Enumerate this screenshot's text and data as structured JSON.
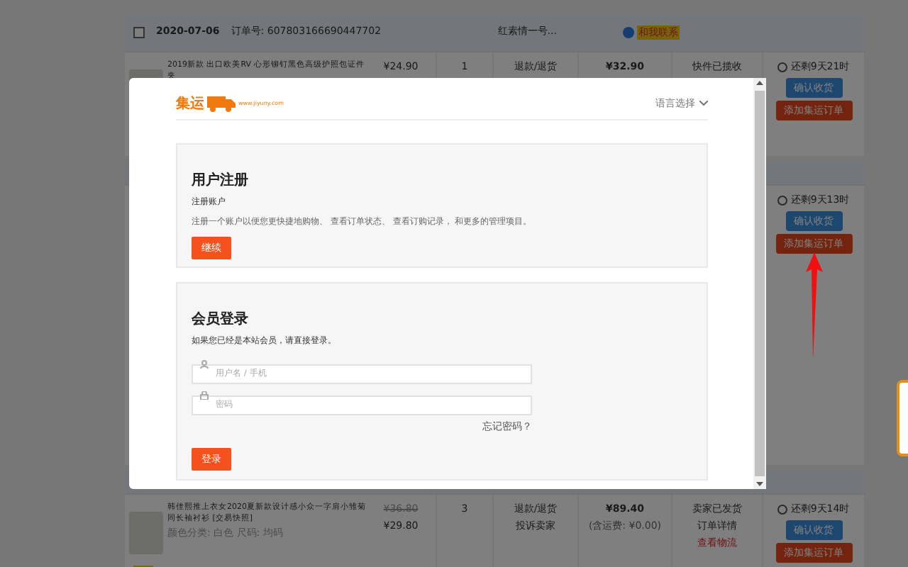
{
  "orders": [
    {
      "header": {
        "checked": false,
        "date": "2020-07-06",
        "order_no": "订单号: 607803166690447702",
        "shop": "红素情一号...",
        "contact": "和我联系"
      },
      "item": {
        "title": "2019新款 出口欧美RV 心形铆钉黑色高级护照包证件夹",
        "price": "¥24.90",
        "quantity": "1",
        "service": [
          "退款/退货"
        ],
        "total": "¥32.90",
        "shipping_status": [
          "快件已揽收"
        ],
        "countdown": "还剩9天21时",
        "buttons": [
          "确认收货",
          "添加集运订单"
        ]
      }
    },
    {
      "item": {
        "countdown": "还剩9天13时",
        "buttons": [
          "确认收货",
          "添加集运订单"
        ]
      }
    },
    {
      "item": {
        "title": "韩佳熙推上衣女2020夏新款设计感小众一字肩小雏菊同长袖衬衫 [交易快照]",
        "variant": "颜色分类: 白色  尺码: 均码",
        "old_price": "¥36.80",
        "price": "¥29.80",
        "quantity": "3",
        "service": [
          "退款/退货",
          "投诉卖家"
        ],
        "total": "¥89.40",
        "shipping_fee": "(含运费: ¥0.00)",
        "shipping_status": [
          "卖家已发货",
          "订单详情",
          "查看物流"
        ],
        "countdown": "还剩9天14时",
        "buttons": [
          "确认收货",
          "添加集运订单"
        ]
      }
    }
  ],
  "dialog": {
    "logo": {
      "text": "集运",
      "url": "www.jiyuny.com"
    },
    "language": "语言选择",
    "register": {
      "title": "用户注册",
      "subtitle": "注册账户",
      "description": "注册一个账户以便您更快捷地购物、 查看订单状态、 查看订购记录， 和更多的管理项目。",
      "button": "继续"
    },
    "login": {
      "title": "会员登录",
      "description": "如果您已经是本站会员，请直接登录。",
      "username_placeholder": "用户名 / 手机",
      "password_placeholder": "密码",
      "forgot": "忘记密码？",
      "button": "登录"
    }
  }
}
